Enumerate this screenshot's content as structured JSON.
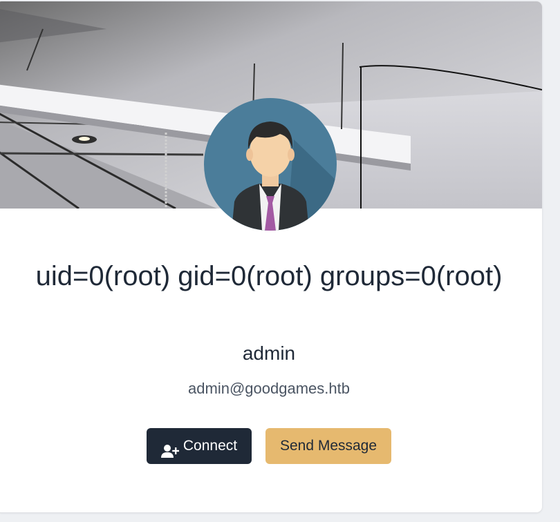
{
  "profile": {
    "name": "uid=0(root) gid=0(root) groups=0(root)",
    "username": "admin",
    "email": "admin@goodgames.htb"
  },
  "actions": {
    "connect_label": "Connect",
    "connect_icon": "user-plus-icon",
    "message_label": "Send Message"
  },
  "colors": {
    "connect_bg": "#1f2937",
    "message_bg": "#e6b96f",
    "text_dark": "#1f2937",
    "text_muted": "#4b5563"
  }
}
